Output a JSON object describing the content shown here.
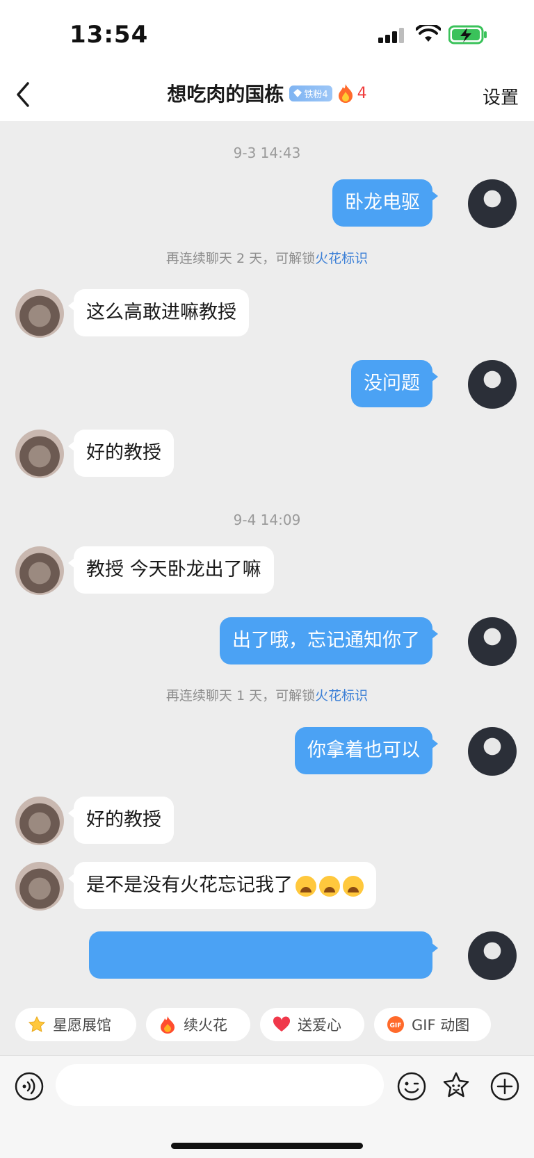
{
  "status_bar": {
    "time": "13:54"
  },
  "header": {
    "title": "想吃肉的国栋",
    "fan_badge": "铁粉4",
    "streak_count": "4",
    "settings_label": "设置"
  },
  "timestamps": [
    "9-3 14:43",
    "9-4 14:09"
  ],
  "hints": [
    {
      "prefix": "再连续聊天 2 天，可解锁",
      "link": "火花标识"
    },
    {
      "prefix": "再连续聊天 1 天，可解锁",
      "link": "火花标识"
    }
  ],
  "messages": [
    {
      "side": "me",
      "text": "卧龙电驱"
    },
    {
      "side": "other",
      "text": "这么高敢进嘛教授"
    },
    {
      "side": "me",
      "text": "没问题"
    },
    {
      "side": "other",
      "text": "好的教授"
    },
    {
      "side": "other",
      "text": "教授 今天卧龙出了嘛"
    },
    {
      "side": "me",
      "text": "出了哦，忘记通知你了"
    },
    {
      "side": "me",
      "text": "你拿着也可以"
    },
    {
      "side": "other",
      "text": "好的教授"
    },
    {
      "side": "other",
      "text": "是不是没有火花忘记我了"
    }
  ],
  "quick_actions": [
    {
      "label": "星愿展馆",
      "icon": "star-icon"
    },
    {
      "label": "续火花",
      "icon": "fire-icon"
    },
    {
      "label": "送爱心",
      "icon": "heart-icon"
    },
    {
      "label": "GIF 动图",
      "icon": "gif-icon"
    }
  ],
  "input": {
    "placeholder": ""
  },
  "colors": {
    "my_bubble": "#4ba2f4",
    "link": "#3b7fd6",
    "streak": "#f03c3c"
  }
}
